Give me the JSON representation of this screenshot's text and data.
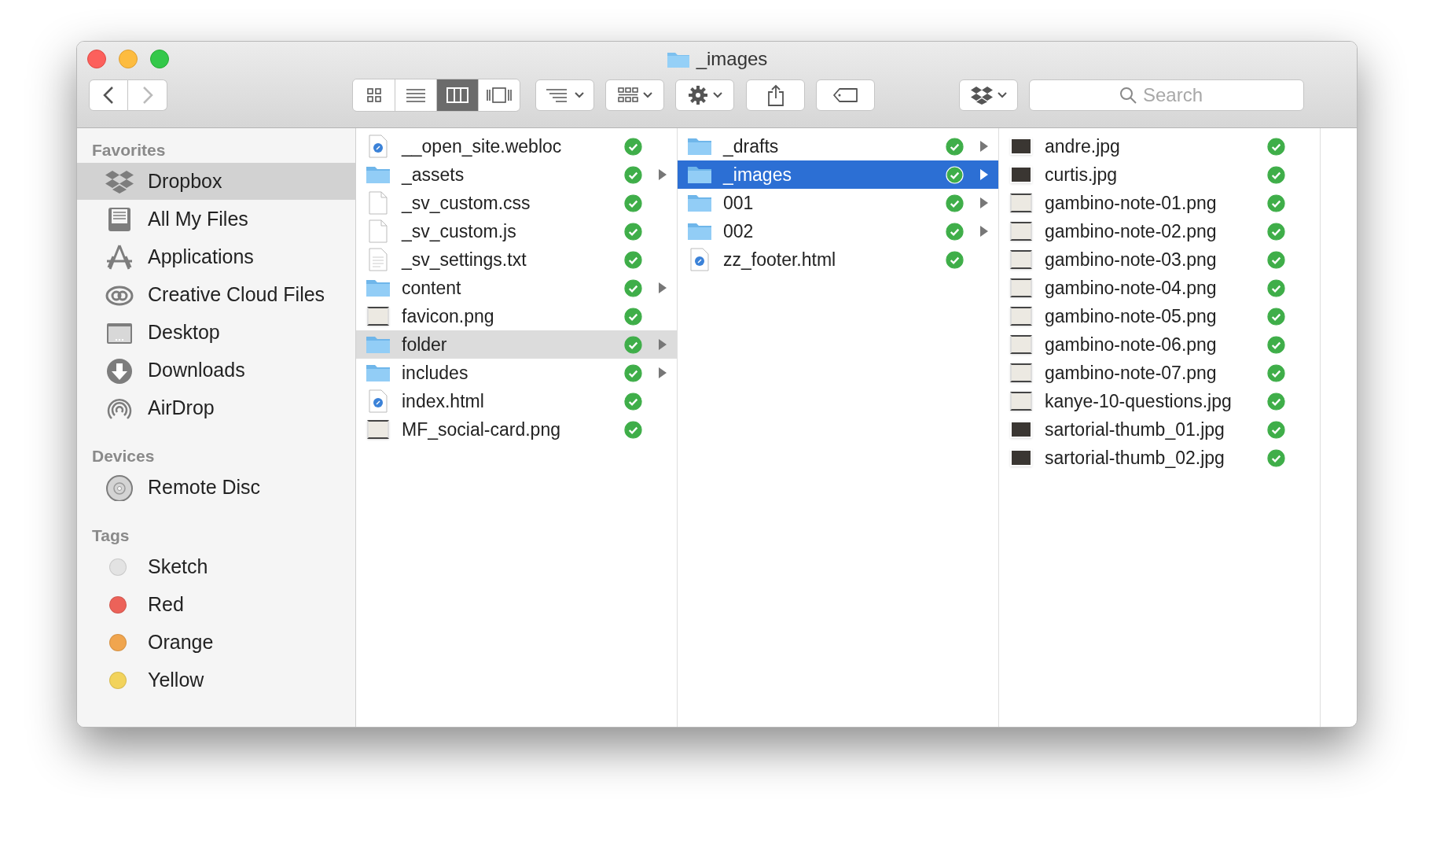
{
  "window": {
    "title": "_images"
  },
  "toolbar": {
    "view_modes": [
      {
        "kind": "icons",
        "selected": false
      },
      {
        "kind": "list",
        "selected": false
      },
      {
        "kind": "columns",
        "selected": true
      },
      {
        "kind": "gallery",
        "selected": false
      }
    ],
    "search": {
      "placeholder": "Search"
    }
  },
  "sidebar": {
    "sections": [
      {
        "heading": "Favorites",
        "items": [
          {
            "label": "Dropbox",
            "kind": "dropbox",
            "selected": true
          },
          {
            "label": "All My Files",
            "kind": "files",
            "selected": false
          },
          {
            "label": "Applications",
            "kind": "apps",
            "selected": false
          },
          {
            "label": "Creative Cloud Files",
            "kind": "cloud",
            "selected": false
          },
          {
            "label": "Desktop",
            "kind": "desktop",
            "selected": false
          },
          {
            "label": "Downloads",
            "kind": "downloads",
            "selected": false
          },
          {
            "label": "AirDrop",
            "kind": "airdrop",
            "selected": false
          }
        ]
      },
      {
        "heading": "Devices",
        "items": [
          {
            "label": "Remote Disc",
            "kind": "disc",
            "selected": false
          }
        ]
      },
      {
        "heading": "Tags",
        "items": [
          {
            "label": "Sketch",
            "kind": "tag",
            "color": "#e3e3e3",
            "selected": false
          },
          {
            "label": "Red",
            "kind": "tag",
            "color": "#ec6259",
            "selected": false
          },
          {
            "label": "Orange",
            "kind": "tag",
            "color": "#f0a54e",
            "selected": false
          },
          {
            "label": "Yellow",
            "kind": "tag",
            "color": "#f2d35c",
            "selected": false
          }
        ]
      }
    ]
  },
  "columns": [
    {
      "active": false,
      "items": [
        {
          "name": "__open_site.webloc",
          "kind": "web",
          "synced": true,
          "expandable": false,
          "selected": false
        },
        {
          "name": "_assets",
          "kind": "folder",
          "synced": true,
          "expandable": true,
          "selected": false
        },
        {
          "name": "_sv_custom.css",
          "kind": "doc",
          "synced": true,
          "expandable": false,
          "selected": false
        },
        {
          "name": "_sv_custom.js",
          "kind": "doc",
          "synced": true,
          "expandable": false,
          "selected": false
        },
        {
          "name": "_sv_settings.txt",
          "kind": "text",
          "synced": true,
          "expandable": false,
          "selected": false
        },
        {
          "name": "content",
          "kind": "folder",
          "synced": true,
          "expandable": true,
          "selected": false
        },
        {
          "name": "favicon.png",
          "kind": "image",
          "synced": true,
          "expandable": false,
          "selected": false
        },
        {
          "name": "folder",
          "kind": "folder",
          "synced": true,
          "expandable": true,
          "selected": true
        },
        {
          "name": "includes",
          "kind": "folder",
          "synced": true,
          "expandable": true,
          "selected": false
        },
        {
          "name": "index.html",
          "kind": "web",
          "synced": true,
          "expandable": false,
          "selected": false
        },
        {
          "name": "MF_social-card.png",
          "kind": "image",
          "synced": true,
          "expandable": false,
          "selected": false
        }
      ]
    },
    {
      "active": true,
      "items": [
        {
          "name": "_drafts",
          "kind": "folder",
          "synced": true,
          "expandable": true,
          "selected": false
        },
        {
          "name": "_images",
          "kind": "folder",
          "synced": true,
          "expandable": true,
          "selected": true
        },
        {
          "name": "001",
          "kind": "folder",
          "synced": true,
          "expandable": true,
          "selected": false
        },
        {
          "name": "002",
          "kind": "folder",
          "synced": true,
          "expandable": true,
          "selected": false
        },
        {
          "name": "zz_footer.html",
          "kind": "web",
          "synced": true,
          "expandable": false,
          "selected": false
        }
      ]
    },
    {
      "active": false,
      "items": [
        {
          "name": "andre.jpg",
          "kind": "photo",
          "synced": true,
          "expandable": false,
          "selected": false
        },
        {
          "name": "curtis.jpg",
          "kind": "photo",
          "synced": true,
          "expandable": false,
          "selected": false
        },
        {
          "name": "gambino-note-01.png",
          "kind": "image",
          "synced": true,
          "expandable": false,
          "selected": false
        },
        {
          "name": "gambino-note-02.png",
          "kind": "image",
          "synced": true,
          "expandable": false,
          "selected": false
        },
        {
          "name": "gambino-note-03.png",
          "kind": "image",
          "synced": true,
          "expandable": false,
          "selected": false
        },
        {
          "name": "gambino-note-04.png",
          "kind": "image",
          "synced": true,
          "expandable": false,
          "selected": false
        },
        {
          "name": "gambino-note-05.png",
          "kind": "image",
          "synced": true,
          "expandable": false,
          "selected": false
        },
        {
          "name": "gambino-note-06.png",
          "kind": "image",
          "synced": true,
          "expandable": false,
          "selected": false
        },
        {
          "name": "gambino-note-07.png",
          "kind": "image",
          "synced": true,
          "expandable": false,
          "selected": false
        },
        {
          "name": "kanye-10-questions.jpg",
          "kind": "image",
          "synced": true,
          "expandable": false,
          "selected": false
        },
        {
          "name": "sartorial-thumb_01.jpg",
          "kind": "photo",
          "synced": true,
          "expandable": false,
          "selected": false
        },
        {
          "name": "sartorial-thumb_02.jpg",
          "kind": "photo",
          "synced": true,
          "expandable": false,
          "selected": false
        }
      ]
    }
  ]
}
